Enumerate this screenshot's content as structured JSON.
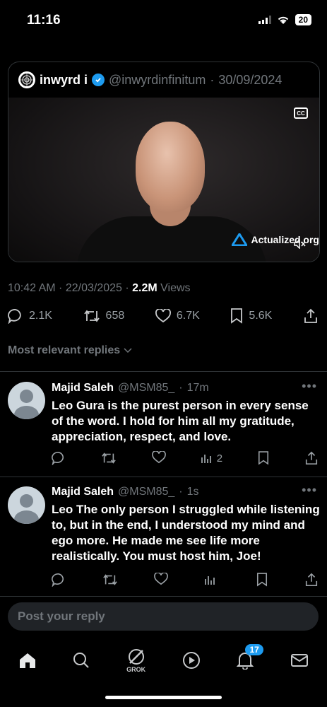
{
  "status": {
    "time": "11:16",
    "battery": "20"
  },
  "quote": {
    "name": "inwyrd i",
    "handle": "@inwyrdinfinitum",
    "date": "30/09/2024",
    "cc_label": "CC",
    "brand": "Actualized.org"
  },
  "tweet": {
    "time": "10:42 AM",
    "date": "22/03/2025",
    "views_count": "2.2M",
    "views_label": "Views"
  },
  "actions": {
    "replies": "2.1K",
    "reposts": "658",
    "likes": "6.7K",
    "bookmarks": "5.6K"
  },
  "replies_filter": "Most relevant replies",
  "replies": [
    {
      "name": "Majid Saleh",
      "handle": "@MSM85_",
      "time": "17m",
      "text": "Leo Gura is the purest person in every sense of the word. I hold for him all my gratitude, appreciation, respect, and love.",
      "views": "2"
    },
    {
      "name": "Majid Saleh",
      "handle": "@MSM85_",
      "time": "1s",
      "text": "Leo The only person I struggled while listening to, but in the end, I understood my mind and ego more. He made me see life more realistically. You must host him, Joe!",
      "views": ""
    }
  ],
  "composer": {
    "placeholder": "Post your reply"
  },
  "tabs": {
    "grok_label": "GROK",
    "notifications_badge": "17"
  }
}
